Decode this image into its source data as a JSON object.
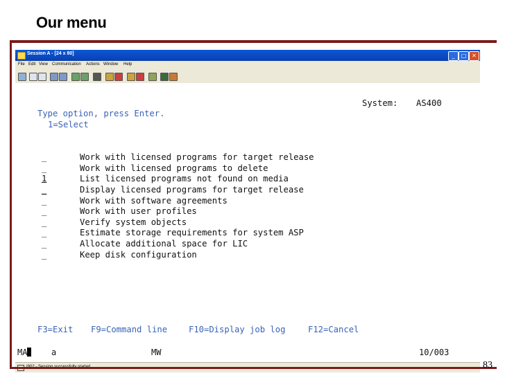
{
  "slide": {
    "title": "Our menu",
    "page_number": "83"
  },
  "window": {
    "title": "Session A - [24 x 80]"
  },
  "menu": [
    "File",
    "Edit",
    "View",
    "Communication",
    "Actions",
    "Window",
    "Help"
  ],
  "screen": {
    "system_label": "System:",
    "system_value": "AS400",
    "instruction": "Type option, press Enter.",
    "option_hint": "1=Select",
    "options": [
      {
        "value": "_",
        "label": "Work with licensed programs for target release"
      },
      {
        "value": "_",
        "label": "Work with licensed programs to delete"
      },
      {
        "value": "1",
        "label": "List licensed programs not found on media"
      },
      {
        "value": "_",
        "label": "Display licensed programs for target release"
      },
      {
        "value": "_",
        "label": "Work with software agreements"
      },
      {
        "value": "_",
        "label": "Work with user profiles"
      },
      {
        "value": "_",
        "label": "Verify system objects"
      },
      {
        "value": "_",
        "label": "Estimate storage requirements for system ASP"
      },
      {
        "value": "_",
        "label": "Allocate additional space for LIC"
      },
      {
        "value": "_",
        "label": "Keep disk configuration"
      }
    ],
    "fkeys": [
      "F3=Exit",
      "F9=Command line",
      "F10=Display job log",
      "F12=Cancel"
    ]
  },
  "status": {
    "ma": "MA",
    "a": "a",
    "mw": "MW",
    "cursor_pos": "10/003"
  },
  "message": "I902 - Session successfully started"
}
